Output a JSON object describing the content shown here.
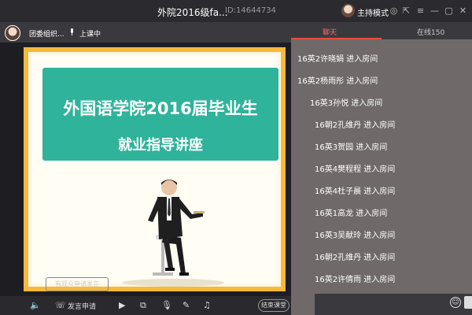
{
  "window": {
    "title": "外院2016级fa...",
    "room_id": "ID:14644734",
    "mode_label": "主持模式"
  },
  "stage": {
    "presenter_name": "团委组织...",
    "class_status": "上课中",
    "slide": {
      "line1": "外国语学院2016届毕业生",
      "line2": "就业指导讲座"
    },
    "request_speak_label": "有观众申请发言"
  },
  "toolbar": {
    "speak_request_label": "发言申请",
    "end_class_label": "结束课堂"
  },
  "panel": {
    "tabs": [
      {
        "label": "聊天"
      },
      {
        "label": "在线150"
      }
    ],
    "messages": [
      {
        "text": "16英2许晓娟 进入房间"
      },
      {
        "text": "16英2杨雨彤 进入房间"
      },
      {
        "text": "16英3孙悦 进入房间"
      },
      {
        "text": "16朝2孔维丹 进入房间"
      },
      {
        "text": "16英3贺园 进入房间"
      },
      {
        "text": "16英4樊程程 进入房间"
      },
      {
        "text": "16英4杜子晨 进入房间"
      },
      {
        "text": "16英1高龙 进入房间"
      },
      {
        "text": "16英3吴献玲 进入房间"
      },
      {
        "text": "16朝2孔维丹 进入房间"
      },
      {
        "text": "16英2许倩雨 进入房间"
      }
    ]
  },
  "colors": {
    "accent": "#e74c3c",
    "banner": "#2fb39b",
    "slide_border": "#f6b93b"
  }
}
